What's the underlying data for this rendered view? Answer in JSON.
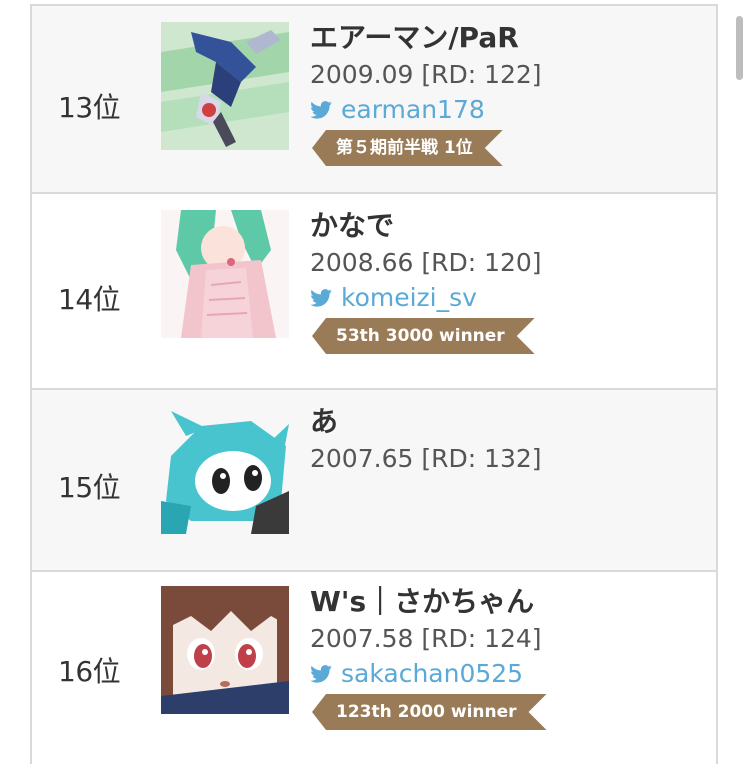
{
  "colors": {
    "badge": "#9a7b58",
    "twitter": "#5aa9d6",
    "row_shaded": "#f7f7f7",
    "border": "#d9d9d9"
  },
  "entries": [
    {
      "rank": "13位",
      "name": "エアーマン/PaR",
      "rating": "2009.09 [RD: 122]",
      "twitter": "earman178",
      "twitter_icon": "twitter-bird-icon",
      "badge": "第５期前半戦 1位"
    },
    {
      "rank": "14位",
      "name": "かなで",
      "rating": "2008.66 [RD: 120]",
      "twitter": "komeizi_sv",
      "twitter_icon": "twitter-bird-icon",
      "badge": "53th 3000 winner"
    },
    {
      "rank": "15位",
      "name": "あ",
      "rating": "2007.65 [RD: 132]"
    },
    {
      "rank": "16位",
      "name": "W's｜さかちゃん",
      "rating": "2007.58 [RD: 124]",
      "twitter": "sakachan0525",
      "twitter_icon": "twitter-bird-icon",
      "badge": "123th 2000 winner"
    }
  ]
}
